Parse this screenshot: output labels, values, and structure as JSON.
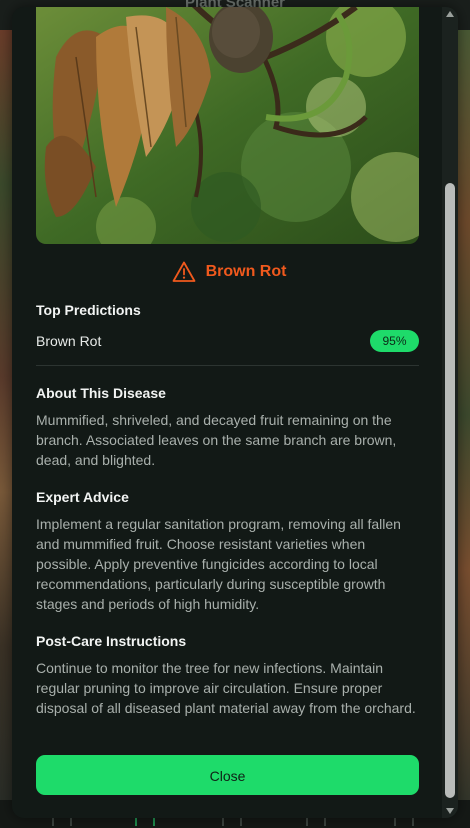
{
  "background": {
    "app_title": "Plant Scanner"
  },
  "modal": {
    "result": {
      "title": "Brown Rot",
      "icon": "warning-triangle-icon",
      "accent_color": "#f0591d"
    },
    "predictions": {
      "heading": "Top Predictions",
      "items": [
        {
          "label": "Brown Rot",
          "confidence": "95%"
        }
      ]
    },
    "about": {
      "heading": "About This Disease",
      "text": "Mummified, shriveled, and decayed fruit remaining on the branch. Associated leaves on the same branch are brown, dead, and blighted."
    },
    "advice": {
      "heading": "Expert Advice",
      "text": "Implement a regular sanitation program, removing all fallen and mummified fruit. Choose resistant varieties when possible. Apply preventive fungicides according to local recommendations, particularly during susceptible growth stages and periods of high humidity."
    },
    "post_care": {
      "heading": "Post-Care Instructions",
      "text": "Continue to monitor the tree for new infections. Maintain regular pruning to improve air circulation. Ensure proper disposal of all diseased plant material away from the orchard."
    },
    "close_label": "Close",
    "button_color": "#1edb6a"
  }
}
